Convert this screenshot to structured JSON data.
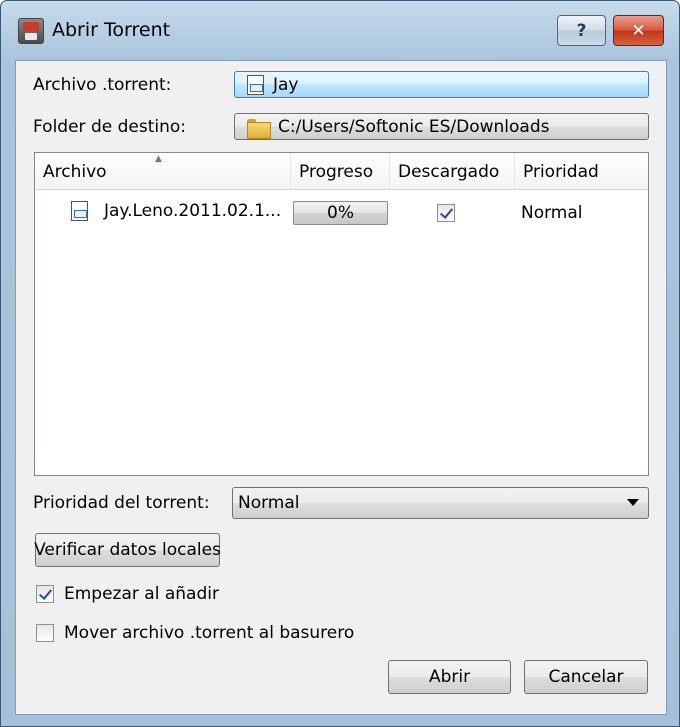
{
  "window": {
    "title": "Abrir Torrent",
    "help_label": "?",
    "close_label": "✕"
  },
  "form": {
    "torrent_label": "Archivo .torrent:",
    "torrent_value": "Jay",
    "dest_label": "Folder de destino:",
    "dest_value": "C:/Users/Softonic ES/Downloads"
  },
  "list": {
    "columns": [
      "Archivo",
      "Progreso",
      "Descargado",
      "Prioridad"
    ],
    "rows": [
      {
        "file": "Jay.Leno.2011.02.1...",
        "progress": "0%",
        "progress_value": 0,
        "downloaded": true,
        "priority": "Normal"
      }
    ]
  },
  "priority": {
    "label": "Prioridad del torrent:",
    "value": "Normal"
  },
  "buttons": {
    "verify": "Verificar datos locales",
    "open": "Abrir",
    "cancel": "Cancelar"
  },
  "options": {
    "start_label": "Empezar al añadir",
    "start_checked": true,
    "move_label": "Mover archivo .torrent al basurero",
    "move_checked": false
  },
  "colors": {
    "titlebar": "#a9c4dc",
    "close_button": "#c23215",
    "progress_fill": "#6cc86a"
  }
}
